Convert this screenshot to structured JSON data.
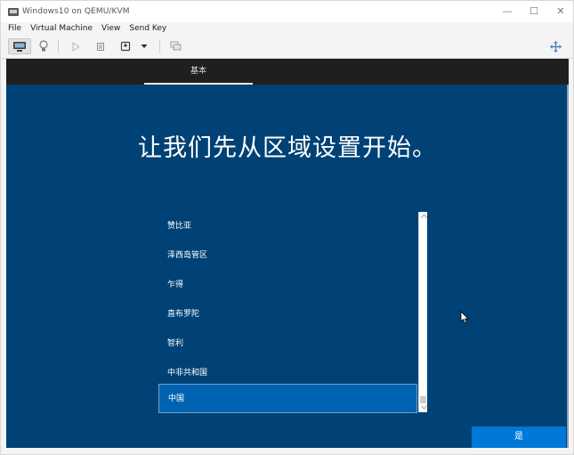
{
  "window": {
    "title": "Windows10 on QEMU/KVM",
    "controls": {
      "minimize": "—",
      "maximize": "☐",
      "close": "✕"
    }
  },
  "menubar": [
    "File",
    "Virtual Machine",
    "View",
    "Send Key"
  ],
  "toolbar": {
    "buttons": [
      "console-view",
      "details-view",
      "run",
      "pause",
      "shutdown",
      "shutdown-menu",
      "snapshots",
      "fullscreen"
    ]
  },
  "oobe": {
    "step_tab": "基本",
    "title": "让我们先从区域设置开始。",
    "regions": [
      "赞比亚",
      "泽西岛管区",
      "乍得",
      "直布罗陀",
      "智利",
      "中非共和国",
      "中国"
    ],
    "selected_region": "中国",
    "yes_button": "是",
    "colors": {
      "background": "#004275",
      "selected": "#0063b1",
      "button": "#0078d7"
    }
  }
}
